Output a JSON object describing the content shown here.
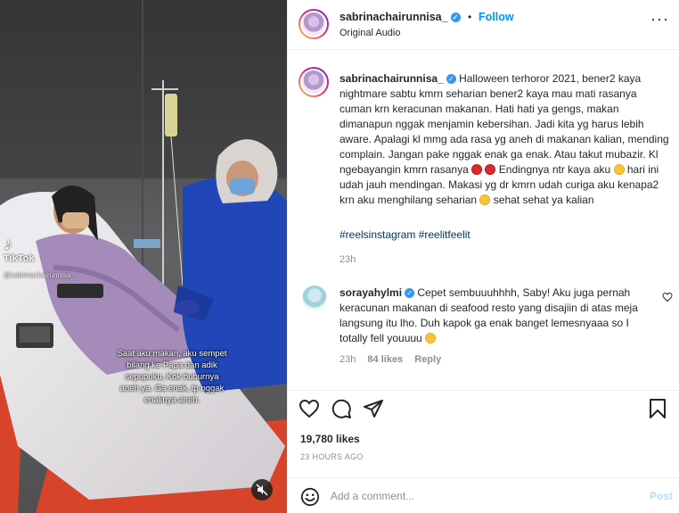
{
  "video": {
    "tiktok_label": "TikTok",
    "tiktok_handle": "@sabrinachairunnisa_",
    "caption_overlay": "Saat aku makan, aku sempet\nbilang ke Papa dan adik\nsepupuku, Kok buburnya\naneh ya. Ga enak, tp nggak\nenaknya aneh.",
    "icons": {
      "tiktok": "tiktok-icon",
      "mute": "mute-icon"
    }
  },
  "header": {
    "username": "sabrinachairunnisa_",
    "follow_label": "Follow",
    "separator": "•",
    "audio": "Original Audio",
    "more_icon": "more-options-icon"
  },
  "caption": {
    "username": "sabrinachairunnisa_",
    "text_1": "Halloween terhoror 2021, bener2 kaya nightmare sabtu kmrn seharian bener2 kaya mau mati rasanya cuman krn keracunan makanan. Hati hati ya gengs, makan dimanapun nggak menjamin kebersihan. Jadi kita yg harus lebih aware. Apalagi kl mmg ada rasa yg aneh di makanan kalian, mending complain. Jangan pake nggak enak ga enak. Atau takut mubazir. Kl ngebayangin kmrn rasanya ",
    "text_2": " Endingnya ntr kaya aku ",
    "text_3": " hari ini udah jauh mendingan. Makasi yg dr kmrn udah curiga aku kenapa2 krn aku menghilang seharian ",
    "text_4": " sehat sehat ya kalian",
    "hashtags": "#reelsinstagram #reelitfeelit",
    "time": "23h"
  },
  "reply": {
    "username": "sorayahylmi",
    "text_1": "Cepet sembuuuhhhh, Saby! Aku juga pernah keracunan makanan di seafood resto yang disajiin di atas meja langsung itu lho. Duh kapok ga enak banget lemesnyaaa so I totally fell youuuu ",
    "time": "23h",
    "likes": "84 likes",
    "reply_label": "Reply"
  },
  "actions": {
    "likes": "19,780 likes",
    "timestamp": "23 HOURS AGO",
    "comment_placeholder": "Add a comment...",
    "post_label": "Post",
    "icons": [
      "heart-icon",
      "comment-icon",
      "share-icon",
      "bookmark-icon",
      "emoji-icon"
    ]
  },
  "colors": {
    "link": "#0095f6",
    "hashtag": "#00376b",
    "muted": "#8e8e8e",
    "post_disabled": "#b2dffc",
    "verified": "#3897f0"
  }
}
